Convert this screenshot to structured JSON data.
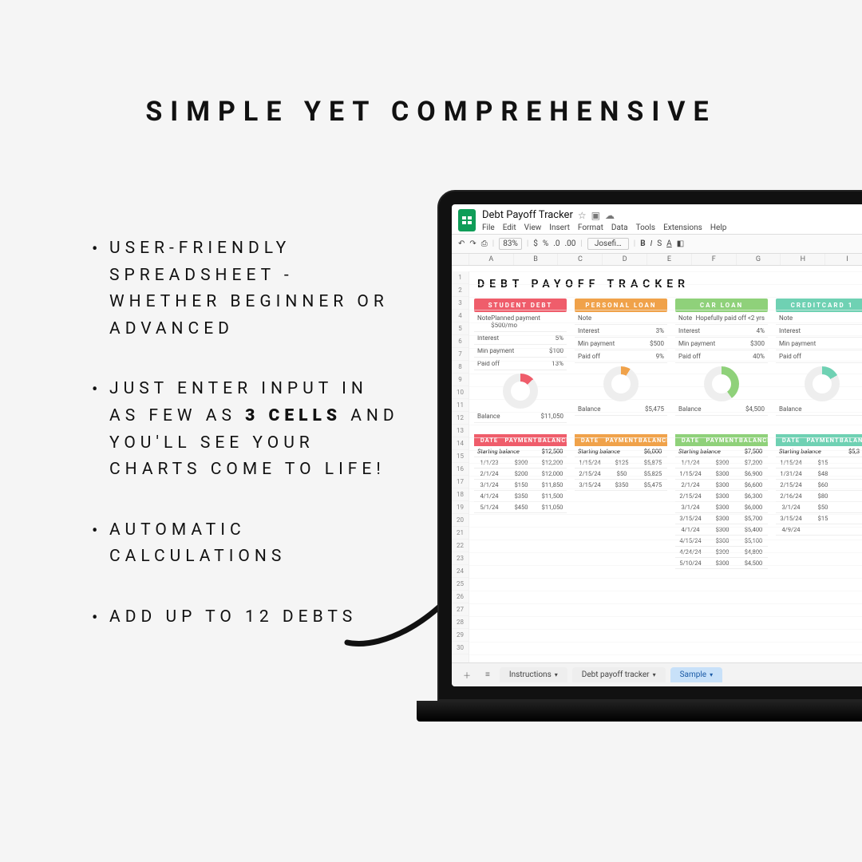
{
  "headline": "SIMPLE YET COMPREHENSIVE",
  "bullets": {
    "b1": "USER-FRIENDLY SPREADSHEET - WHETHER BEGINNER OR ADVANCED",
    "b2a": "JUST ENTER INPUT IN AS FEW AS ",
    "b2bold": "3 CELLS",
    "b2b": " AND YOU'LL SEE YOUR CHARTS COME TO LIFE!",
    "b3": "AUTOMATIC CALCULATIONS",
    "b4": "ADD UP TO 12 DEBTS"
  },
  "sheets": {
    "doc_title": "Debt Payoff Tracker",
    "menus": [
      "File",
      "Edit",
      "View",
      "Insert",
      "Format",
      "Data",
      "Tools",
      "Extensions",
      "Help"
    ],
    "toolbar": {
      "zoom": "83%",
      "currency": "$",
      "percent": "%",
      "font": "Josefi…"
    },
    "columns": [
      "",
      "A",
      "B",
      "C",
      "D",
      "E",
      "F",
      "G",
      "H",
      "I"
    ],
    "rowcount": 30,
    "sheet_title": "DEBT PAYOFF TRACKER",
    "tabs": {
      "t1": "Instructions",
      "t2": "Debt payoff tracker",
      "t3": "Sample"
    }
  },
  "debts": [
    {
      "name": "STUDENT DEBT",
      "color": "#ef5d6b",
      "note": "Planned payment $500/mo",
      "interest": "5%",
      "min": "$100",
      "paidoff": "13%",
      "balance": "$11,050",
      "donut_deg": 47,
      "start": "$12,500",
      "rows": [
        [
          "1/1/23",
          "$300",
          "$12,200"
        ],
        [
          "2/1/24",
          "$200",
          "$12,000"
        ],
        [
          "3/1/24",
          "$150",
          "$11,850"
        ],
        [
          "4/1/24",
          "$350",
          "$11,500"
        ],
        [
          "5/1/24",
          "$450",
          "$11,050"
        ]
      ]
    },
    {
      "name": "PERSONAL LOAN",
      "color": "#f0a24a",
      "note": "",
      "interest": "3%",
      "min": "$500",
      "paidoff": "9%",
      "balance": "$5,475",
      "donut_deg": 32,
      "start": "$6,000",
      "rows": [
        [
          "1/15/24",
          "$125",
          "$5,875"
        ],
        [
          "2/15/24",
          "$50",
          "$5,825"
        ],
        [
          "3/15/24",
          "$350",
          "$5,475"
        ]
      ]
    },
    {
      "name": "CAR LOAN",
      "color": "#8fd17a",
      "note": "Hopefully paid off <2 yrs",
      "interest": "4%",
      "min": "$300",
      "paidoff": "40%",
      "balance": "$4,500",
      "donut_deg": 144,
      "start": "$7,500",
      "rows": [
        [
          "1/1/24",
          "$300",
          "$7,200"
        ],
        [
          "1/15/24",
          "$300",
          "$6,900"
        ],
        [
          "2/1/24",
          "$300",
          "$6,600"
        ],
        [
          "2/15/24",
          "$300",
          "$6,300"
        ],
        [
          "3/1/24",
          "$300",
          "$6,000"
        ],
        [
          "3/15/24",
          "$300",
          "$5,700"
        ],
        [
          "4/1/24",
          "$300",
          "$5,400"
        ],
        [
          "4/15/24",
          "$300",
          "$5,100"
        ],
        [
          "4/24/24",
          "$300",
          "$4,800"
        ],
        [
          "5/10/24",
          "$300",
          "$4,500"
        ]
      ]
    },
    {
      "name": "CREDITCARD 1",
      "color": "#6fd1b3",
      "note": "",
      "interest": "",
      "min": "",
      "paidoff": "",
      "balance": "",
      "donut_deg": 60,
      "start": "$5,3",
      "rows": [
        [
          "1/15/24",
          "$15",
          ""
        ],
        [
          "1/31/24",
          "$48",
          ""
        ],
        [
          "2/15/24",
          "$60",
          ""
        ],
        [
          "2/16/24",
          "$80",
          ""
        ],
        [
          "3/1/24",
          "$50",
          ""
        ],
        [
          "3/15/24",
          "$15",
          ""
        ],
        [
          "4/9/24",
          "",
          ""
        ]
      ]
    }
  ]
}
